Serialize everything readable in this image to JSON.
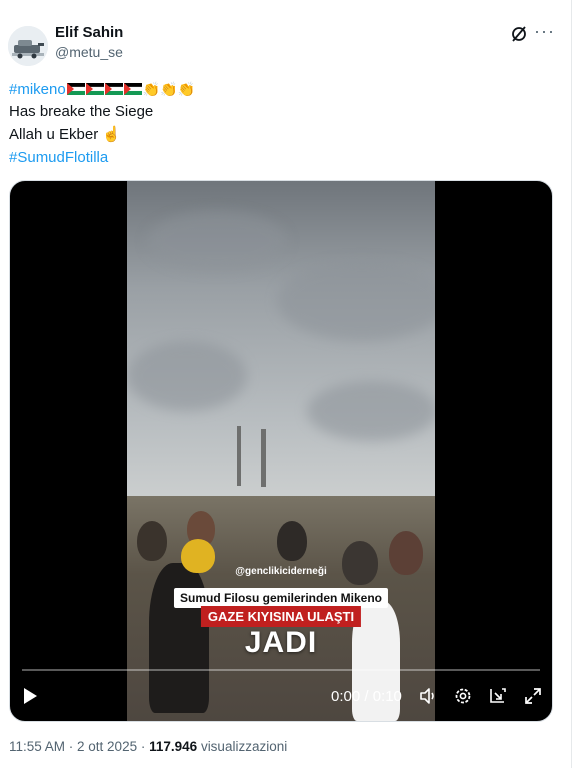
{
  "author": {
    "name": "Elif Sahin",
    "handle": "@metu_se"
  },
  "tweet": {
    "hashtag1": "#mikeno",
    "line2": "Has breake the Siege",
    "line3": "Allah u Ekber",
    "hashtag2": "#SumudFlotilla"
  },
  "video": {
    "watermark": "@genclikiciderneği",
    "caption1": "Sumud Filosu gemilerinden Mikeno",
    "caption2": "GAZE KIYISINA ULAŞTI",
    "caption3": "JADI",
    "time": "0:00 / 0:10",
    "progress": 0
  },
  "meta": {
    "time_date": "11:55 AM · 2 ott 2025 ·",
    "views_count": "117.946",
    "views_label": "visualizzazioni"
  },
  "icons": [
    "avatar",
    "grok-icon",
    "more-icon",
    "palestine-flag",
    "clapping-hands",
    "pointing-finger",
    "play-icon",
    "volume-icon",
    "settings-icon",
    "pip-icon",
    "fullscreen-icon"
  ],
  "colors": {
    "link": "#1d9bf0",
    "secondary": "#536471",
    "caption_red": "#c0201f"
  }
}
